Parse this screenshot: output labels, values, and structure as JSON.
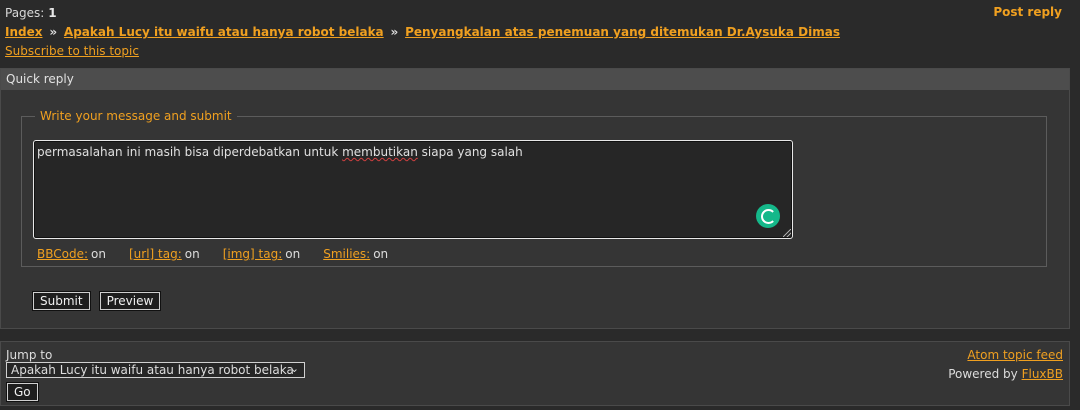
{
  "header": {
    "pages_label": "Pages:",
    "pages_value": "1",
    "post_reply": "Post reply"
  },
  "breadcrumb": {
    "index": "Index",
    "forum": "Apakah Lucy itu waifu atau hanya robot belaka",
    "topic": "Penyangkalan atas penemuan yang ditemukan Dr.Aysuka Dimas",
    "separator": "»"
  },
  "subscribe": "Subscribe to this topic",
  "quick_reply": {
    "title": "Quick reply",
    "legend": "Write your message and submit",
    "message_before": "permasalahan ini masih bisa diperdebatkan untuk ",
    "message_misspelled": "membutikan",
    "message_after": " siapa yang salah",
    "bbcode": {
      "label": "BBCode:",
      "value": "on"
    },
    "url_tag": {
      "label": "[url] tag:",
      "value": "on"
    },
    "img_tag": {
      "label": "[img] tag:",
      "value": "on"
    },
    "smilies": {
      "label": "Smilies:",
      "value": "on"
    },
    "submit": "Submit",
    "preview": "Preview"
  },
  "footer": {
    "jump_to": "Jump to",
    "selected_forum": "Apakah Lucy itu waifu atau hanya robot belaka",
    "go": "Go",
    "atom_feed": "Atom topic feed",
    "powered_by": "Powered by",
    "fluxbb": "FluxBB"
  },
  "colors": {
    "accent": "#f0a020",
    "background": "#2a2a2a",
    "panel": "#353535",
    "grammar_button": "#15b88a"
  },
  "icons": [
    "grammar-check-icon",
    "chevron-down-icon",
    "resize-handle-icon"
  ]
}
